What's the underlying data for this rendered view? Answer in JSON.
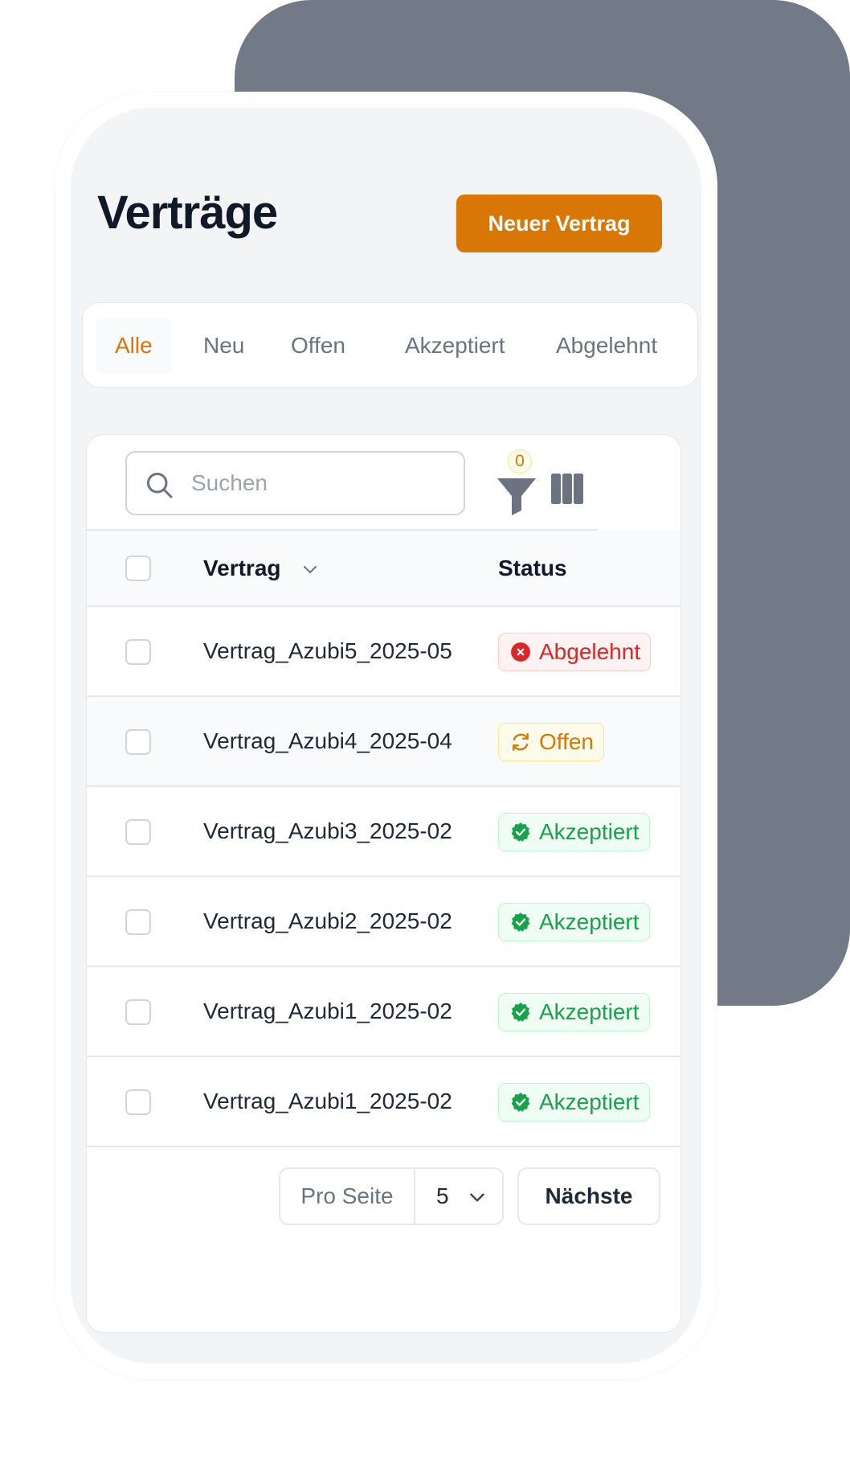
{
  "header": {
    "title": "Verträge",
    "new_button_label": "Neuer Vertrag"
  },
  "tabs": [
    {
      "label": "Alle",
      "active": true
    },
    {
      "label": "Neu",
      "active": false
    },
    {
      "label": "Offen",
      "active": false
    },
    {
      "label": "Akzeptiert",
      "active": false
    },
    {
      "label": "Abgelehnt",
      "active": false
    }
  ],
  "toolbar": {
    "search_placeholder": "Suchen",
    "search_value": "",
    "filter_count": "0",
    "icons": [
      "search-icon",
      "filter-icon",
      "columns-icon"
    ]
  },
  "table": {
    "columns": [
      {
        "label": "Vertrag",
        "sortable": true
      },
      {
        "label": "Status"
      }
    ],
    "rows": [
      {
        "name": "Vertrag_Azubi5_2025-05",
        "status": "Abgelehnt",
        "status_type": "rejected"
      },
      {
        "name": "Vertrag_Azubi4_2025-04",
        "status": "Offen",
        "status_type": "open"
      },
      {
        "name": "Vertrag_Azubi3_2025-02",
        "status": "Akzeptiert",
        "status_type": "accepted"
      },
      {
        "name": "Vertrag_Azubi2_2025-02",
        "status": "Akzeptiert",
        "status_type": "accepted"
      },
      {
        "name": "Vertrag_Azubi1_2025-02",
        "status": "Akzeptiert",
        "status_type": "accepted"
      },
      {
        "name": "Vertrag_Azubi1_2025-02",
        "status": "Akzeptiert",
        "status_type": "accepted"
      }
    ]
  },
  "pagination": {
    "per_page_label": "Pro Seite",
    "per_page_value": "5",
    "next_label": "Nächste"
  },
  "colors": {
    "accent": "#d97706",
    "backdrop": "#717a86",
    "rejected": "#dc2626",
    "open": "#d97706",
    "accepted": "#16a34a"
  }
}
